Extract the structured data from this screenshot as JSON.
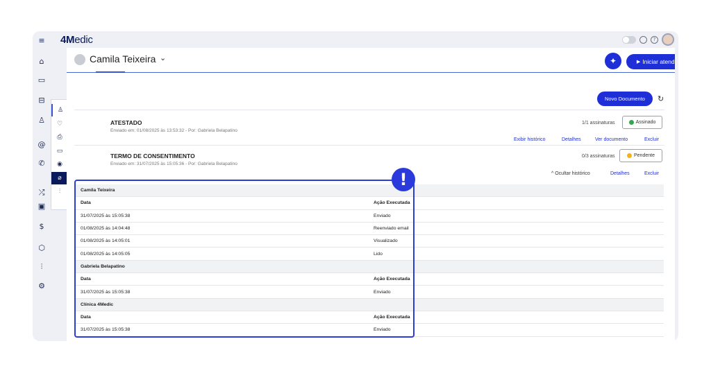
{
  "app": {
    "logo_bold": "4M",
    "logo_rest": "edic"
  },
  "left_rail": {
    "items": [
      {
        "icon": "menu-icon",
        "glyph": "≡"
      },
      {
        "icon": "home-icon",
        "glyph": "⌂"
      },
      {
        "icon": "calendar-icon",
        "glyph": "▭"
      },
      {
        "icon": "inbox-icon",
        "glyph": "⊟"
      },
      {
        "icon": "users-icon",
        "glyph": "♙"
      },
      {
        "icon": "at-icon",
        "glyph": "@"
      },
      {
        "icon": "phone-icon",
        "glyph": "✆"
      },
      {
        "icon": "shuffle-icon",
        "glyph": "⤮"
      },
      {
        "icon": "clipboard-icon",
        "glyph": "▣"
      },
      {
        "icon": "dollar-icon",
        "glyph": "$"
      },
      {
        "icon": "box-icon",
        "glyph": "⬡"
      },
      {
        "icon": "chart-icon",
        "glyph": "⫶"
      },
      {
        "icon": "settings-icon",
        "glyph": "⚙"
      }
    ]
  },
  "patient": {
    "name": "Camila Teixeira",
    "chevron": "⌄"
  },
  "header": {
    "sparkle": "✦",
    "start_button": "Iniciar atendimento",
    "play": "▶"
  },
  "sub_rail": {
    "items": [
      {
        "icon": "person-icon",
        "glyph": "♙"
      },
      {
        "icon": "heartbeat-icon",
        "glyph": "♡"
      },
      {
        "icon": "printer-icon",
        "glyph": "⎙"
      },
      {
        "icon": "folder-icon",
        "glyph": "▭"
      },
      {
        "icon": "camera-icon",
        "glyph": "◉"
      },
      {
        "icon": "paperclip-icon",
        "glyph": "⌀"
      },
      {
        "icon": "chart-icon",
        "glyph": "⫶"
      }
    ]
  },
  "toolbar": {
    "new_document": "Novo Documento",
    "refresh": "↻"
  },
  "documents": [
    {
      "title": "ATESTADO",
      "subtitle": "Enviado em: 01/08/2025 às 13:53:32 - Por: Gabriela Belapatino",
      "signatures": "1/1 assinaturas",
      "status": "Assinado",
      "status_color": "#2fa84f",
      "links": [
        "Exibir histórico",
        "Detalhes",
        "Ver documento",
        "Excluir"
      ]
    },
    {
      "title": "TERMO DE CONSENTIMENTO",
      "subtitle": "Enviado em: 31/07/2025 às 15:05:36 - Por: Gabriela Belapatino",
      "signatures": "0/3 assinaturas",
      "status": "Pendente",
      "status_color": "#f2b21b",
      "links": [
        "^ Ocultar histórico",
        "Detalhes",
        "Excluir"
      ]
    }
  ],
  "history": {
    "groups": [
      {
        "name": "Camila Teixeira",
        "col_date": "Data",
        "col_action": "Ação Executada",
        "rows": [
          {
            "date": "31/07/2025 às 15:05:38",
            "action": "Enviado"
          },
          {
            "date": "01/08/2025 às 14:04:48",
            "action": "Reenviado email"
          },
          {
            "date": "01/08/2025 às 14:05:01",
            "action": "Visualizado"
          },
          {
            "date": "01/08/2025 às 14:05:05",
            "action": "Lido"
          }
        ]
      },
      {
        "name": "Gabriela Belapatino",
        "col_date": "Data",
        "col_action": "Ação Executada",
        "rows": [
          {
            "date": "31/07/2025 às 15:05:38",
            "action": "Enviado"
          }
        ]
      },
      {
        "name": "Clínica 4Medic",
        "col_date": "Data",
        "col_action": "Ação Executada",
        "rows": [
          {
            "date": "31/07/2025 às 15:05:38",
            "action": "Enviado"
          }
        ]
      }
    ]
  },
  "annotation": {
    "badge": "!"
  }
}
